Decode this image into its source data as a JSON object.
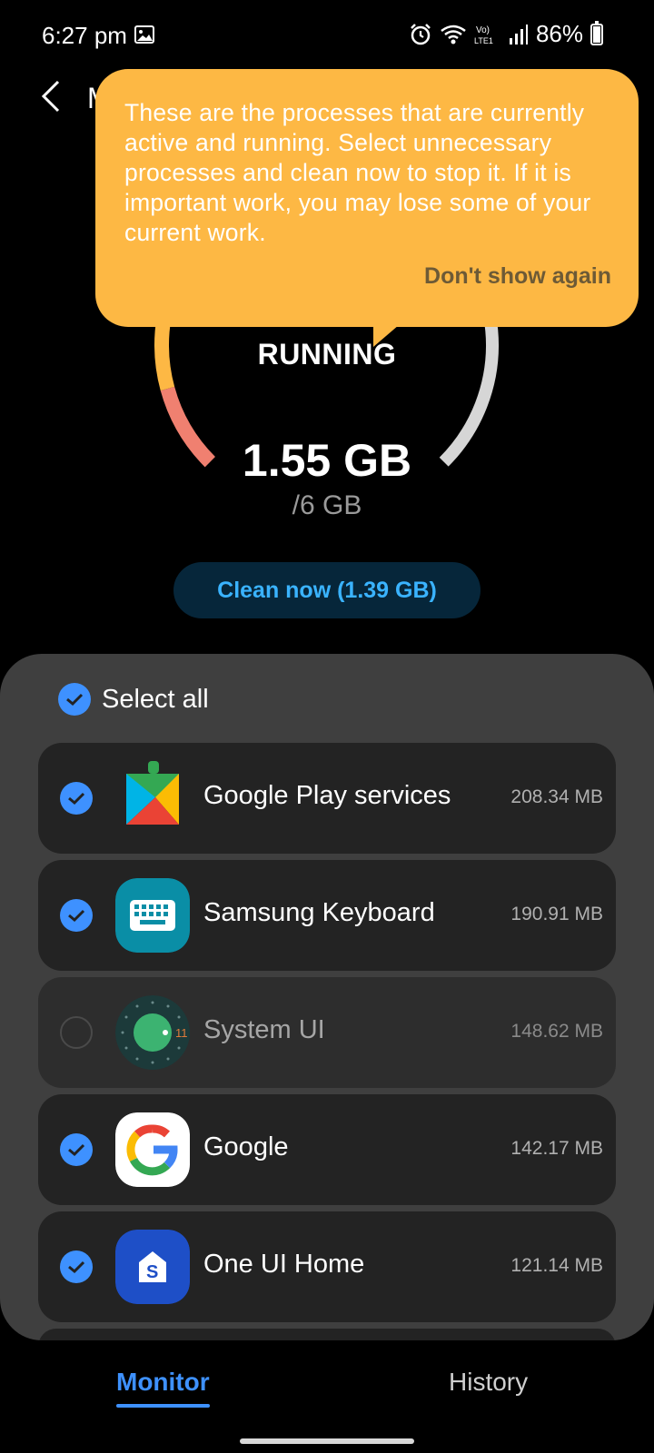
{
  "status_bar": {
    "time": "6:27 pm",
    "battery": "86%",
    "network_label": "Vo) LTE1"
  },
  "header": {
    "title_initial": "M"
  },
  "gauge": {
    "label": "RUNNING",
    "used": "1.55 GB",
    "total": "/6 GB",
    "used_fraction": 0.258,
    "colors": {
      "segment_a": "#fdb844",
      "segment_b": "#f08070",
      "remaining": "#d6d6d6"
    }
  },
  "clean_button": {
    "label": "Clean now (1.39 GB)"
  },
  "tooltip": {
    "text": "These are the processes that are currently active and running. Select unnecessary processes and clean now to stop it. If it is important work, you may lose some of your current work.",
    "dismiss_label": "Don't show again"
  },
  "select_all": {
    "label": "Select all",
    "checked": true
  },
  "processes": [
    {
      "name": "Google Play services",
      "size": "208.34 MB",
      "checked": true,
      "icon": "google-play-services-icon"
    },
    {
      "name": "Samsung Keyboard",
      "size": "190.91 MB",
      "checked": true,
      "icon": "samsung-keyboard-icon"
    },
    {
      "name": "System UI",
      "size": "148.62 MB",
      "checked": false,
      "icon": "system-ui-icon",
      "badge": "11"
    },
    {
      "name": "Google",
      "size": "142.17 MB",
      "checked": true,
      "icon": "google-icon"
    },
    {
      "name": "One UI Home",
      "size": "121.14 MB",
      "checked": true,
      "icon": "one-ui-home-icon",
      "badge": "S"
    }
  ],
  "tabs": [
    {
      "label": "Monitor",
      "active": true
    },
    {
      "label": "History",
      "active": false
    }
  ],
  "colors": {
    "accent": "#3e91ff",
    "tooltip_bg": "#fdb844",
    "clean_text": "#3ab3ff"
  }
}
